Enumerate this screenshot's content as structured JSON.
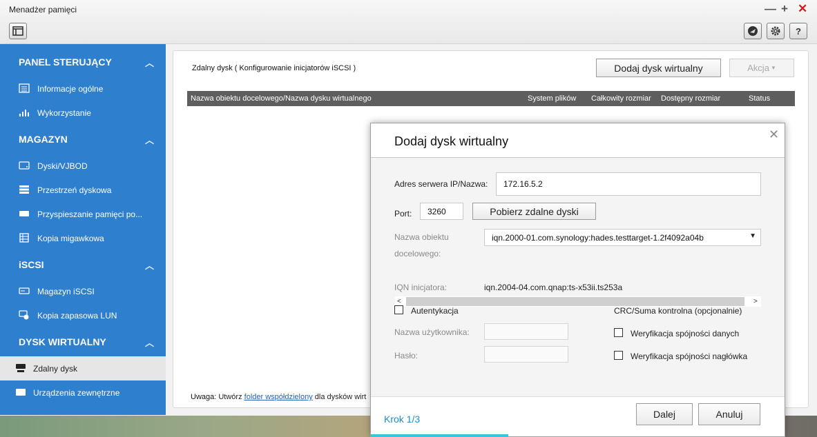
{
  "app": {
    "title": "Menadżer pamięci",
    "controls": {
      "minimize": "—",
      "maximize": "+",
      "close": "✕"
    }
  },
  "toolbar": {
    "layout_icon": "layout-icon",
    "external_icon": "external-app-icon",
    "settings_icon": "gear-icon",
    "help_label": "?"
  },
  "sidebar": {
    "sections": [
      {
        "label": "PANEL STERUJĄCY",
        "items": [
          {
            "label": "Informacje ogólne",
            "icon": "overview-icon"
          },
          {
            "label": "Wykorzystanie",
            "icon": "usage-chart-icon"
          }
        ]
      },
      {
        "label": "MAGAZYN",
        "items": [
          {
            "label": "Dyski/VJBOD",
            "icon": "disk-icon"
          },
          {
            "label": "Przestrzeń dyskowa",
            "icon": "storage-space-icon"
          },
          {
            "label": "Przyspieszanie pamięci po...",
            "icon": "cache-icon"
          },
          {
            "label": "Kopia migawkowa",
            "icon": "snapshot-icon"
          }
        ]
      },
      {
        "label": "iSCSI",
        "items": [
          {
            "label": "Magazyn iSCSI",
            "icon": "iscsi-storage-icon"
          },
          {
            "label": "Kopia zapasowa LUN",
            "icon": "lun-backup-icon"
          }
        ]
      },
      {
        "label": "DYSK WIRTUALNY",
        "items": [
          {
            "label": "Zdalny dysk",
            "icon": "remote-disk-icon",
            "active": true
          },
          {
            "label": "Urządzenia zewnętrzne",
            "icon": "external-device-icon"
          }
        ]
      }
    ]
  },
  "main": {
    "title": "Zdalny dysk ( Konfigurowanie inicjatorów iSCSI )",
    "add_button": "Dodaj dysk wirtualny",
    "action_button": "Akcja",
    "table_headers": [
      "Nazwa obiektu docelowego/Nazwa dysku wirtualnego",
      "System plików",
      "Całkowity rozmiar",
      "Dostępny rozmiar",
      "Status"
    ],
    "note_prefix": "Uwaga:",
    "note_text1": " Utwórz ",
    "note_link": "folder współdzielony",
    "note_text2": " dla dysków wirt"
  },
  "dialog": {
    "title": "Dodaj dysk wirtualny",
    "server_label": "Adres serwera IP/Nazwa:",
    "server_value": "172.16.5.2",
    "port_label": "Port:",
    "port_value": "3260",
    "fetch_button": "Pobierz zdalne dyski",
    "target_label_1": "Nazwa obiektu",
    "target_label_2": "docelowego:",
    "target_value": "iqn.2000-01.com.synology:hades.testtarget-1.2f4092a04b",
    "iqn_label": "IQN inicjatora:",
    "iqn_value": "iqn.2004-04.com.qnap:ts-x53ii.ts253a",
    "auth_label": "Autentykacja",
    "auth_checked": false,
    "username_label": "Nazwa użytkownika:",
    "password_label": "Hasło:",
    "crc_title": "CRC/Suma kontrolna (opcjonalnie)",
    "data_digest_label": "Weryfikacja spójności danych",
    "data_digest_checked": false,
    "header_digest_label": "Weryfikacja spójności nagłówka",
    "header_digest_checked": false,
    "step": "Krok 1/3",
    "next_button": "Dalej",
    "cancel_button": "Anuluj",
    "progress_fraction": 0.333
  },
  "colors": {
    "sidebar_bg": "#2f7fcf",
    "table_header_bg": "#5e5e5e",
    "accent": "#1e8ec9",
    "close_red": "#d31b1b"
  }
}
